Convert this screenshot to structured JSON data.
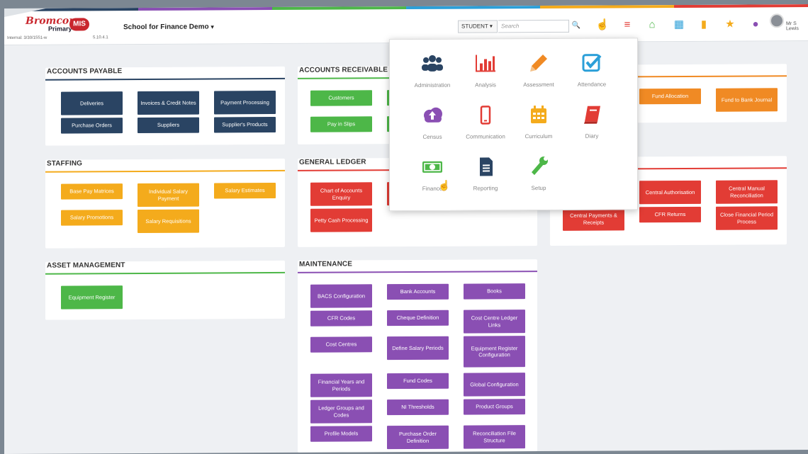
{
  "header": {
    "logo_text": "Bromcom",
    "logo_sub": "Primary",
    "logo_badge": "MIS",
    "logo_meta": "Internal: 3/30/1551-w",
    "version": "5.10.4.1",
    "school_name": "School for Finance Demo",
    "scope_label": "STUDENT",
    "search_placeholder": "Search",
    "user_name": "Mr S Lewis"
  },
  "stripe_colors": [
    "#2a4463",
    "#8a4fb3",
    "#4db748",
    "#2b9fd8",
    "#f4ab1c",
    "#e23c35"
  ],
  "sections": {
    "accounts_payable": {
      "title": "ACCOUNTS PAYABLE",
      "color": "#2a4463",
      "tiles": [
        "Deliveries",
        "Invoices & Credit Notes",
        "Payment Processing",
        "Purchase Orders",
        "Suppliers",
        "Supplier's Products"
      ]
    },
    "accounts_receivable": {
      "title": "ACCOUNTS RECEIVABLE",
      "color": "#4db748",
      "tiles": [
        "Customers",
        "Pay in Slips"
      ]
    },
    "banking": {
      "color": "#f08a24",
      "tiles": [
        "Fund Allocation",
        "Fund to Bank Journal"
      ]
    },
    "staffing": {
      "title": "STAFFING",
      "color": "#f4ab1c",
      "tiles": [
        "Base Pay Matrices",
        "Individual Salary Payment",
        "Salary Estimates",
        "Salary Promotions",
        "Salary Requisitions"
      ]
    },
    "general_ledger": {
      "title": "GENERAL LEDGER",
      "color": "#e23c35",
      "tiles": [
        "Chart of Accounts Enquiry",
        "Petty Cash Processing"
      ]
    },
    "central": {
      "color": "#e23c35",
      "tiles": [
        "Central Authorisation",
        "Central Manual Reconciliation",
        "Central Payments & Receipts",
        "CFR Returns",
        "Close Financial Period Process"
      ]
    },
    "asset_management": {
      "title": "ASSET MANAGEMENT",
      "color": "#4db748",
      "tiles": [
        "Equipment Register"
      ]
    },
    "maintenance": {
      "title": "MAINTENANCE",
      "color": "#8a4fb3",
      "tiles": [
        "BACS Configuration",
        "Bank Accounts",
        "Books",
        "CFR Codes",
        "Cheque Definition",
        "Cost Centre Ledger Links",
        "Cost Centres",
        "Define Salary Periods",
        "Equipment Register Configuration",
        "Financial Years and Periods",
        "Fund Codes",
        "Global Configuration",
        "Ledger Groups and Codes",
        "NI Thresholds",
        "Product Groups",
        "Profile Models",
        "Purchase Order Definition",
        "Reconciliation File Structure"
      ]
    }
  },
  "menu": {
    "items": [
      {
        "label": "Administration",
        "icon": "people-icon",
        "color": "#2a4463"
      },
      {
        "label": "Analysis",
        "icon": "bar-chart-icon",
        "color": "#e23c35"
      },
      {
        "label": "Assessment",
        "icon": "pencil-icon",
        "color": "#f08a24"
      },
      {
        "label": "Attendance",
        "icon": "checkbox-icon",
        "color": "#2b9fd8"
      },
      {
        "label": "Census",
        "icon": "cloud-upload-icon",
        "color": "#8a4fb3"
      },
      {
        "label": "Communication",
        "icon": "mobile-icon",
        "color": "#e23c35"
      },
      {
        "label": "Curriculum",
        "icon": "calendar-icon",
        "color": "#f4ab1c"
      },
      {
        "label": "Diary",
        "icon": "book-icon",
        "color": "#e23c35"
      },
      {
        "label": "Finance",
        "icon": "money-icon",
        "color": "#4db748"
      },
      {
        "label": "Reporting",
        "icon": "document-icon",
        "color": "#2a4463"
      },
      {
        "label": "Setup",
        "icon": "wrench-icon",
        "color": "#4db748"
      }
    ]
  }
}
